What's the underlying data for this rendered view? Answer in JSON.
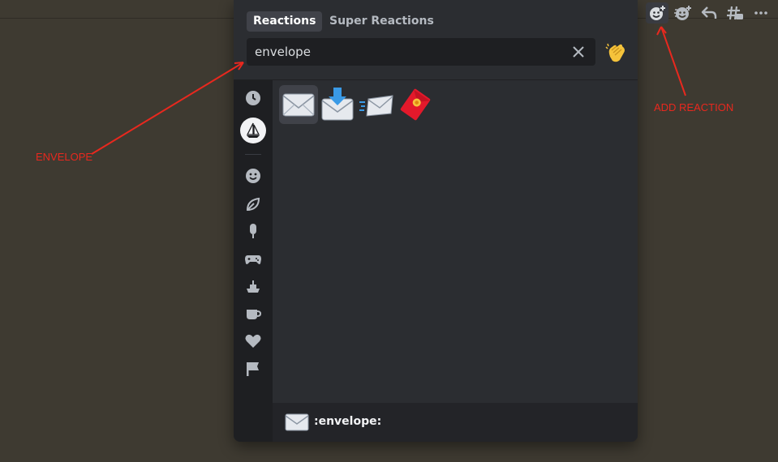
{
  "picker": {
    "tabs": [
      {
        "label": "Reactions",
        "active": true
      },
      {
        "label": "Super Reactions",
        "active": false
      }
    ],
    "search": {
      "value": "envelope",
      "placeholder": ""
    },
    "side_categories": [
      "recent-icon",
      "server-emoji-icon",
      "people-icon",
      "nature-icon",
      "food-icon",
      "activities-icon",
      "travel-icon",
      "objects-icon",
      "symbols-icon",
      "flags-icon"
    ],
    "results": [
      {
        "name": "envelope",
        "selected": true
      },
      {
        "name": "envelope-with-arrow",
        "selected": false
      },
      {
        "name": "incoming-envelope",
        "selected": false
      },
      {
        "name": "red-envelope",
        "selected": false
      }
    ],
    "footer": {
      "emoji_name": ":envelope:"
    }
  },
  "toolbar": {
    "buttons": [
      "add-reaction-icon",
      "super-reaction-icon",
      "reply-icon",
      "thread-icon",
      "more-icon"
    ]
  },
  "annotations": {
    "envelope_label": "ENVELOPE",
    "add_reaction_label": "ADD REACTION",
    "color": "#e8281e"
  },
  "colors": {
    "background": "#3e3a31",
    "picker": "#2b2d31",
    "sidebar": "#1e1f22",
    "accent_text": "#ffffff"
  }
}
